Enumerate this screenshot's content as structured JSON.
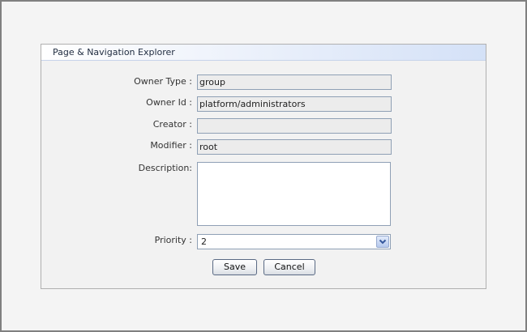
{
  "panel": {
    "title": "Page & Navigation Explorer"
  },
  "form": {
    "owner_type": {
      "label": "Owner Type :",
      "value": "group"
    },
    "owner_id": {
      "label": "Owner Id :",
      "value": "platform/administrators"
    },
    "creator": {
      "label": "Creator :",
      "value": ""
    },
    "modifier": {
      "label": "Modifier :",
      "value": "root"
    },
    "description": {
      "label": "Description:",
      "value": ""
    },
    "priority": {
      "label": "Priority :",
      "value": "2"
    }
  },
  "buttons": {
    "save": "Save",
    "cancel": "Cancel"
  },
  "icons": {
    "select_arrow": "chevron-down-icon"
  },
  "colors": {
    "header_gradient_end": "#d4e1f7",
    "input_border": "#8fa0b5",
    "select_arrow": "#35579c"
  }
}
